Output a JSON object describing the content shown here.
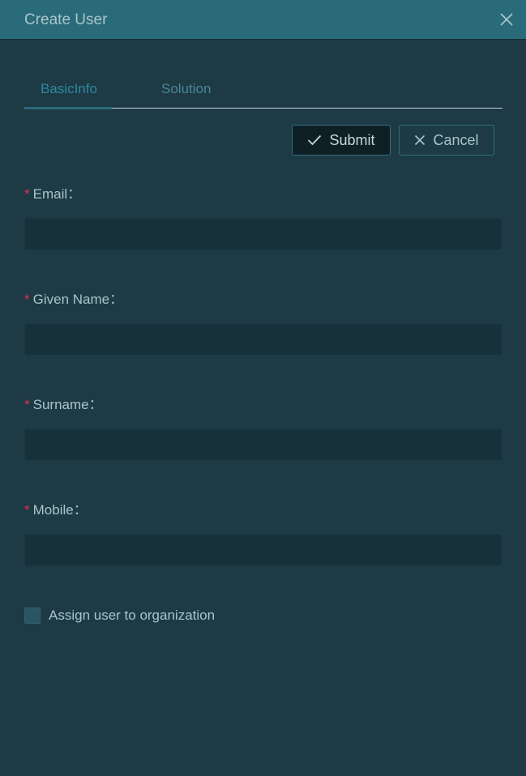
{
  "dialog": {
    "title": "Create User"
  },
  "tabs": [
    {
      "label": "BasicInfo",
      "active": true
    },
    {
      "label": "Solution",
      "active": false
    }
  ],
  "actions": {
    "submit_label": "Submit",
    "cancel_label": "Cancel"
  },
  "fields": [
    {
      "label": "Email",
      "separator": "：",
      "required": true,
      "value": "",
      "placeholder": ""
    },
    {
      "label": "Given Name",
      "separator": "：",
      "required": true,
      "value": "",
      "placeholder": ""
    },
    {
      "label": "Surname",
      "separator": "：",
      "required": true,
      "value": "",
      "placeholder": ""
    },
    {
      "label": "Mobile",
      "separator": "：",
      "required": true,
      "value": "",
      "placeholder": ""
    }
  ],
  "assign_org": {
    "label": "Assign user to organization",
    "checked": false
  },
  "icons": {
    "close": "close-icon",
    "submit": "check-icon",
    "cancel": "x-icon"
  },
  "colors": {
    "titlebar": "#2a6b7a",
    "background": "#1d3a45",
    "input_bg": "#16313a",
    "active_tab": "#2f8aa0",
    "required_mark": "#e0324a"
  }
}
